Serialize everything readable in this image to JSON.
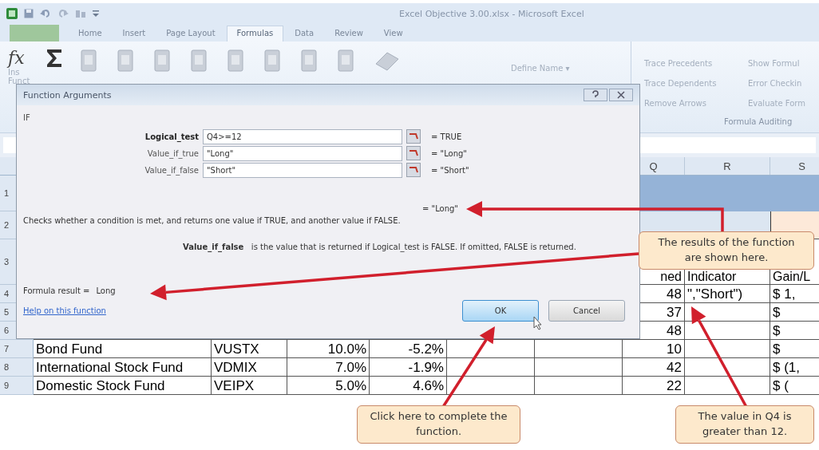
{
  "window": {
    "title": "Excel Objective 3.00.xlsx - Microsoft Excel"
  },
  "ribbon_tabs": [
    {
      "label": "Home",
      "selected": false
    },
    {
      "label": "Insert",
      "selected": false
    },
    {
      "label": "Page Layout",
      "selected": false
    },
    {
      "label": "Formulas",
      "selected": true
    },
    {
      "label": "Data",
      "selected": false
    },
    {
      "label": "Review",
      "selected": false
    },
    {
      "label": "View",
      "selected": false
    }
  ],
  "ribbon": {
    "function_icon": "fx",
    "insert_function_label": [
      "Ins",
      "Funct"
    ],
    "define_name": "Define Name ▾",
    "auditing": [
      [
        "Trace Precedents",
        "Show Formul"
      ],
      [
        "Trace Dependents",
        "Error Checkin"
      ],
      [
        "Remove Arrows",
        "Evaluate Form"
      ]
    ],
    "group_label": "Formula Auditing"
  },
  "dialog": {
    "title": "Function Arguments",
    "function": "IF",
    "arguments": [
      {
        "name": "Logical_test",
        "value": "Q4>=12",
        "result": "=  TRUE",
        "bold": true
      },
      {
        "name": "Value_if_true",
        "value": "\"Long\"",
        "result": "=  \"Long\"",
        "bold": false
      },
      {
        "name": "Value_if_false",
        "value": "\"Short\"",
        "result": "=  \"Short\"",
        "bold": false
      }
    ],
    "overall_result": "= \"Long\"",
    "description": "Checks whether a condition is met, and returns one value if TRUE, and another value if FALSE.",
    "argument_help": {
      "name": "Value_if_false",
      "text": "is the value that is returned if Logical_test is FALSE. If omitted, FALSE is returned."
    },
    "formula_result_label": "Formula result =",
    "formula_result": "Long",
    "help_link": "Help on this function",
    "buttons": [
      "OK",
      "Cancel"
    ]
  },
  "sheet": {
    "column_headers": [
      "Q",
      "R",
      "S"
    ],
    "rows": [
      {
        "number": "1",
        "kind": "title"
      },
      {
        "number": "2",
        "kind": "subtitle"
      },
      {
        "number": "3",
        "kind": "header",
        "q": "ned",
        "r": "Indicator",
        "s": "Gain/L"
      },
      {
        "number": "4",
        "kind": "data",
        "q": "48",
        "r": "\",\"Short\")",
        "s": "$   1,"
      },
      {
        "number": "5",
        "kind": "data",
        "q": "37",
        "s": "$"
      },
      {
        "number": "6",
        "kind": "data",
        "q": "48",
        "s": "$"
      },
      {
        "number": "7",
        "kind": "data",
        "a": "Bond Fund",
        "b": "VUSTX",
        "c": "10.0%",
        "d": "-5.2%",
        "q": "10",
        "s": "$"
      },
      {
        "number": "8",
        "kind": "data",
        "a": "International Stock Fund",
        "b": "VDMIX",
        "c": "7.0%",
        "d": "-1.9%",
        "q": "42",
        "s": "$  (1,"
      },
      {
        "number": "9",
        "kind": "data",
        "a": "Domestic Stock Fund",
        "b": "VEIPX",
        "c": "5.0%",
        "d": "4.6%",
        "q": "22",
        "s": "$     ("
      }
    ]
  },
  "callouts": [
    "The results of the function are shown here.",
    "Click here to complete the function.",
    "The value in Q4 is greater than 12."
  ]
}
